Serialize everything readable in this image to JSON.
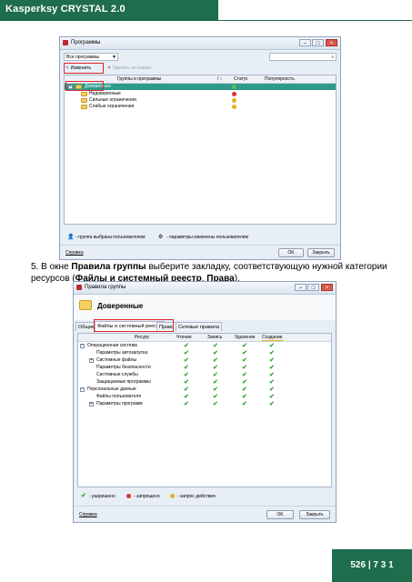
{
  "header": {
    "title": "Kasperksy CRYSTAL 2.0"
  },
  "win1": {
    "title": "Программы",
    "filter_value": "Все программы",
    "toolbar": {
      "edit_label": "Изменить",
      "remove_label": "Удалить из списка"
    },
    "columns": [
      "Группы и программы",
      "Статус",
      "Популярность"
    ],
    "rows": [
      "Доверенные",
      "Недоверенные",
      "Сильные ограничения",
      "Слабые ограничения"
    ],
    "legend": {
      "group_text": "- группа выбрана пользователем",
      "params_text": "- параметры изменены пользователем"
    },
    "footer": {
      "help": "Справка",
      "ok": "OK",
      "close": "Закрыть"
    }
  },
  "instruction": {
    "prefix": "5. В окне ",
    "b1": "Правила группы",
    "mid1": " выберите закладку, соответствующую нужной категории ресурсов (",
    "b2": "Файлы и системный реестр",
    "mid2": ", ",
    "b3": "Права",
    "suffix": ")."
  },
  "win2": {
    "title": "Правила группы",
    "heading": "Доверенные",
    "tabs": [
      "Общие",
      "Файлы и системный реестр",
      "Право",
      "Сетевые правила"
    ],
    "columns": [
      "Ресурс",
      "Чтение",
      "Запись",
      "Удаление",
      "Создание"
    ],
    "rows": [
      {
        "label": "Операционная система",
        "expander": "−",
        "indent": 0,
        "checks": [
          true,
          true,
          true,
          true
        ]
      },
      {
        "label": "Параметры автозапуска",
        "expander": "",
        "indent": 1,
        "checks": [
          true,
          true,
          true,
          true
        ]
      },
      {
        "label": "Системные файлы",
        "expander": "+",
        "indent": 1,
        "checks": [
          true,
          true,
          true,
          true
        ]
      },
      {
        "label": "Параметры безопасности",
        "expander": "",
        "indent": 1,
        "checks": [
          true,
          true,
          true,
          true
        ]
      },
      {
        "label": "Системные службы",
        "expander": "",
        "indent": 1,
        "checks": [
          true,
          true,
          true,
          true
        ]
      },
      {
        "label": "Защищаемые программы",
        "expander": "",
        "indent": 1,
        "checks": [
          true,
          true,
          true,
          true
        ]
      },
      {
        "label": "Персональные данные",
        "expander": "−",
        "indent": 0,
        "checks": [
          true,
          true,
          true,
          true
        ]
      },
      {
        "label": "Файлы пользователя",
        "expander": "",
        "indent": 1,
        "checks": [
          true,
          true,
          true,
          true
        ]
      },
      {
        "label": "Параметры программ",
        "expander": "+",
        "indent": 1,
        "checks": [
          true,
          true,
          true,
          true
        ]
      }
    ],
    "legend": {
      "allowed": "- разрешено",
      "forbidden": "- запрещено",
      "request": "- запрос действия"
    },
    "footer": {
      "help": "Справка",
      "ok": "OK",
      "close": "Закрыть"
    }
  },
  "page_number": "526 | 7 3 1",
  "colors": {
    "brand": "#1e6d4c",
    "highlight": "#e0262a",
    "selected_row": "#2d9a8c",
    "allow": "#3aa637"
  }
}
